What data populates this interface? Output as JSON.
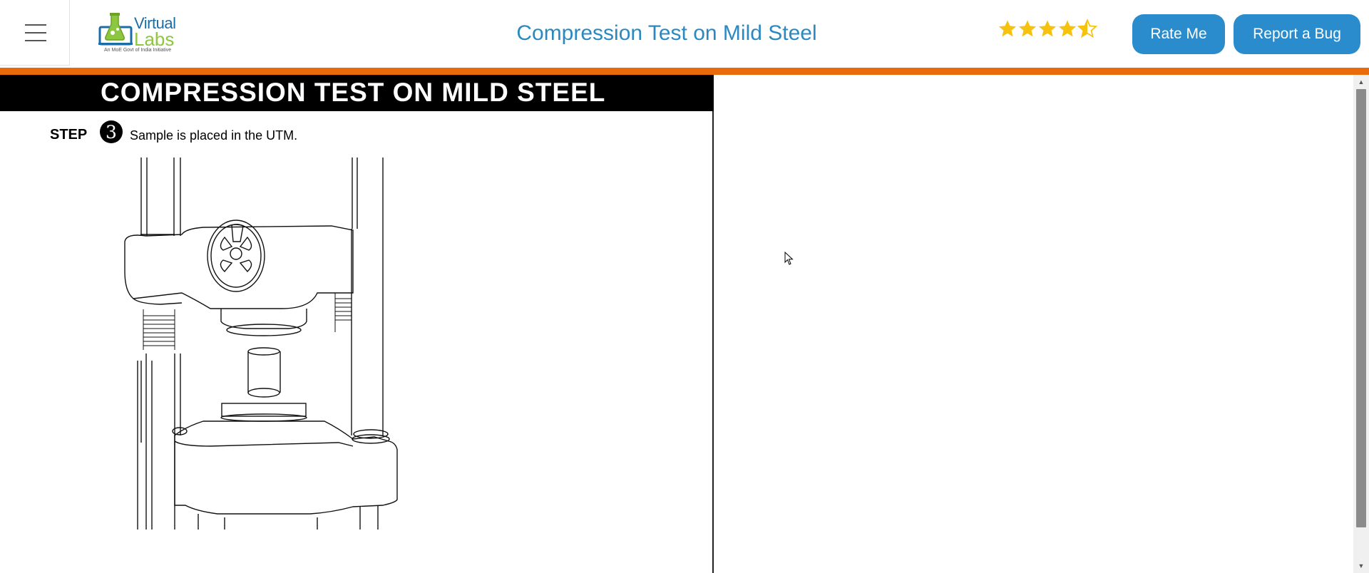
{
  "header": {
    "menu_icon": "hamburger-menu-icon",
    "logo": {
      "line1": "Virtual",
      "line2": "Labs",
      "tagline": "An MoE Govt of India Initiative"
    },
    "title": "Compression Test on Mild Steel",
    "rating": {
      "value": 4.5,
      "max": 5,
      "icon": "star-icon"
    },
    "rate_button": "Rate Me",
    "bug_button": "Report a Bug"
  },
  "colors": {
    "accent_orange": "#ea6a0b",
    "button_blue": "#2a8ccc",
    "title_blue": "#2c89c0",
    "star_gold": "#f6c20e"
  },
  "experiment": {
    "banner": "COMPRESSION TEST ON MILD STEEL",
    "step_label": "STEP",
    "step_number": "3",
    "step_text": "Sample is placed in the UTM.",
    "illustration": "utm-machine-with-sample"
  }
}
